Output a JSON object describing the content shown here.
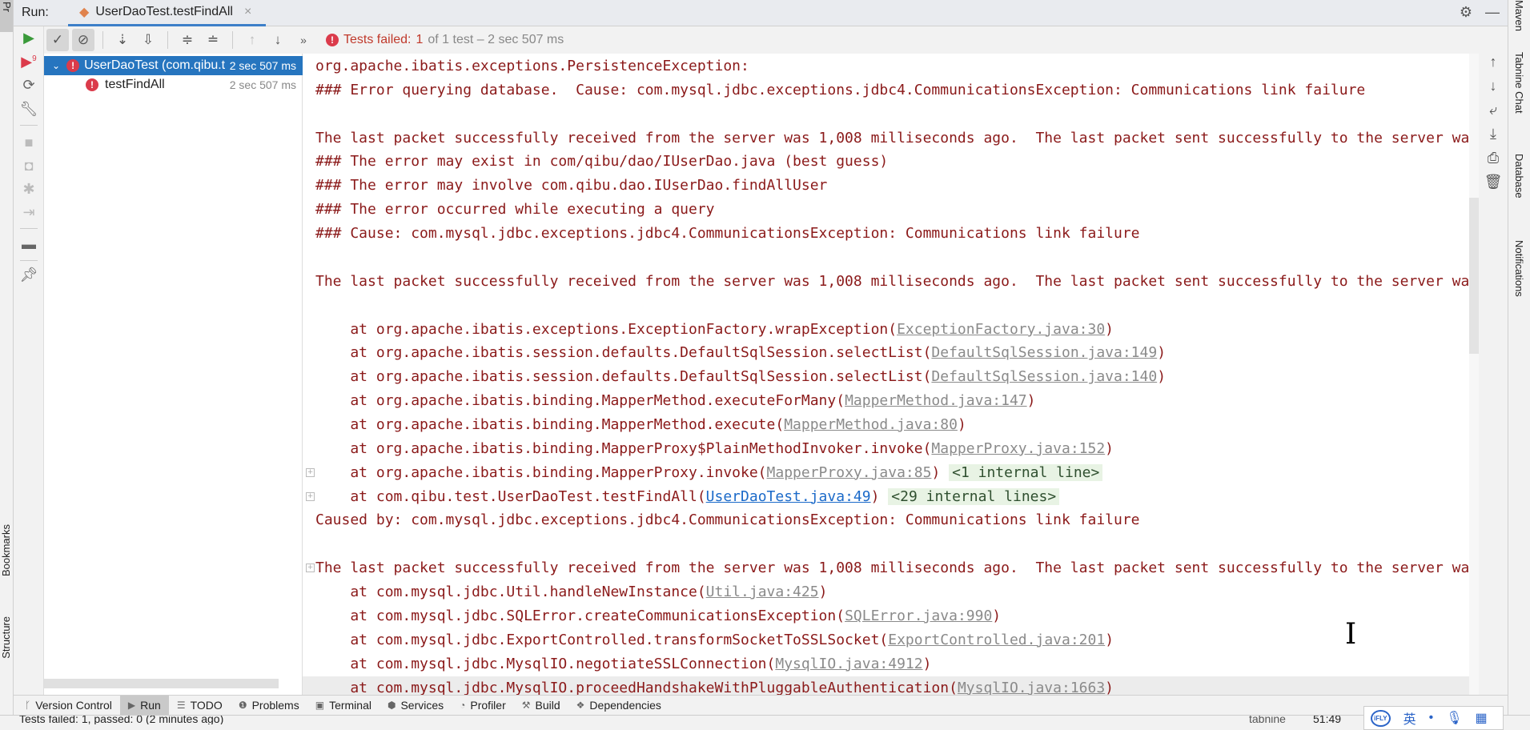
{
  "left_strip": {
    "project_label": "Pr",
    "bookmarks": "Bookmarks",
    "structure": "Structure"
  },
  "tab_bar": {
    "run_label": "Run:",
    "tab_title": "UserDaoTest.testFindAll",
    "close": "×"
  },
  "toolbar": {
    "status_prefix": "Tests failed:",
    "failed_count": "1",
    "status_rest": "of 1 test – 2 sec 507 ms",
    "more": "»"
  },
  "tree": {
    "items": [
      {
        "label": "UserDaoTest (com.qibu.t",
        "time": "2 sec 507 ms",
        "selected": true
      },
      {
        "label": "testFindAll",
        "time": "2 sec 507 ms",
        "selected": false
      }
    ]
  },
  "console": {
    "lines": [
      {
        "pre": "org.apache.ibatis.exceptions.PersistenceException:"
      },
      {
        "pre": "### Error querying database.  Cause: com.mysql.jdbc.exceptions.jdbc4.CommunicationsException: Communications link failure"
      },
      {
        "pre": ""
      },
      {
        "pre": "The last packet successfully received from the server was 1,008 milliseconds ago.  The last packet sent successfully to the server wa"
      },
      {
        "pre": "### The error may exist in com/qibu/dao/IUserDao.java (best guess)"
      },
      {
        "pre": "### The error may involve com.qibu.dao.IUserDao.findAllUser"
      },
      {
        "pre": "### The error occurred while executing a query"
      },
      {
        "pre": "### Cause: com.mysql.jdbc.exceptions.jdbc4.CommunicationsException: Communications link failure"
      },
      {
        "pre": ""
      },
      {
        "pre": "The last packet successfully received from the server was 1,008 milliseconds ago.  The last packet sent successfully to the server wa"
      },
      {
        "pre": ""
      },
      {
        "pre": "    at org.apache.ibatis.exceptions.ExceptionFactory.wrapException(",
        "link": "ExceptionFactory.java:30",
        "post": ")"
      },
      {
        "pre": "    at org.apache.ibatis.session.defaults.DefaultSqlSession.selectList(",
        "link": "DefaultSqlSession.java:149",
        "post": ")"
      },
      {
        "pre": "    at org.apache.ibatis.session.defaults.DefaultSqlSession.selectList(",
        "link": "DefaultSqlSession.java:140",
        "post": ")"
      },
      {
        "pre": "    at org.apache.ibatis.binding.MapperMethod.executeForMany(",
        "link": "MapperMethod.java:147",
        "post": ")"
      },
      {
        "pre": "    at org.apache.ibatis.binding.MapperMethod.execute(",
        "link": "MapperMethod.java:80",
        "post": ")"
      },
      {
        "pre": "    at org.apache.ibatis.binding.MapperProxy$PlainMethodInvoker.invoke(",
        "link": "MapperProxy.java:152",
        "post": ")"
      },
      {
        "pre": "    at org.apache.ibatis.binding.MapperProxy.invoke(",
        "link": "MapperProxy.java:85",
        "post": ") ",
        "internal": "<1 internal line>",
        "fold": true
      },
      {
        "pre": "    at com.qibu.test.UserDaoTest.testFindAll(",
        "link": "UserDaoTest.java:49",
        "link_blue": true,
        "post": ") ",
        "internal": "<29 internal lines>",
        "fold": true
      },
      {
        "pre": "Caused by: com.mysql.jdbc.exceptions.jdbc4.CommunicationsException: Communications link failure"
      },
      {
        "pre": ""
      },
      {
        "pre": "The last packet successfully received from the server was 1,008 milliseconds ago.  The last packet sent successfully to the server wa",
        "fold": true
      },
      {
        "pre": "    at com.mysql.jdbc.Util.handleNewInstance(",
        "link": "Util.java:425",
        "post": ")"
      },
      {
        "pre": "    at com.mysql.jdbc.SQLError.createCommunicationsException(",
        "link": "SQLError.java:990",
        "post": ")"
      },
      {
        "pre": "    at com.mysql.jdbc.ExportControlled.transformSocketToSSLSocket(",
        "link": "ExportControlled.java:201",
        "post": ")"
      },
      {
        "pre": "    at com.mysql.jdbc.MysqlIO.negotiateSSLConnection(",
        "link": "MysqlIO.java:4912",
        "post": ")"
      },
      {
        "pre": "    at com.mysql.jdbc.MysqlIO.proceedHandshakeWithPluggableAuthentication(",
        "link": "MysqlIO.java:1663",
        "post": ")",
        "current": true
      }
    ]
  },
  "right_strip": {
    "maven": "Maven",
    "tabnine": "Tabnine Chat",
    "database": "Database",
    "notifications": "Notifications"
  },
  "bottom_tools": [
    {
      "label": "Version Control",
      "icon": "branch-icon"
    },
    {
      "label": "Run",
      "icon": "run-icon",
      "active": true
    },
    {
      "label": "TODO",
      "icon": "list-icon"
    },
    {
      "label": "Problems",
      "icon": "problems-icon"
    },
    {
      "label": "Terminal",
      "icon": "terminal-icon"
    },
    {
      "label": "Services",
      "icon": "services-icon"
    },
    {
      "label": "Profiler",
      "icon": "profiler-icon"
    },
    {
      "label": "Build",
      "icon": "build-icon"
    },
    {
      "label": "Dependencies",
      "icon": "dependencies-icon"
    }
  ],
  "status_bar": {
    "message": "Tests failed: 1, passed: 0 (2 minutes ago)",
    "tabnine": "tabnine",
    "position": "51:49"
  },
  "ime": {
    "logo": "iFLY",
    "lang": "英"
  },
  "colors": {
    "error": "#db3b4b",
    "console_text": "#8b1a1a",
    "selection": "#2675bf",
    "link_blue": "#1b6ac9",
    "internal_bg": "#e8f3e4"
  }
}
